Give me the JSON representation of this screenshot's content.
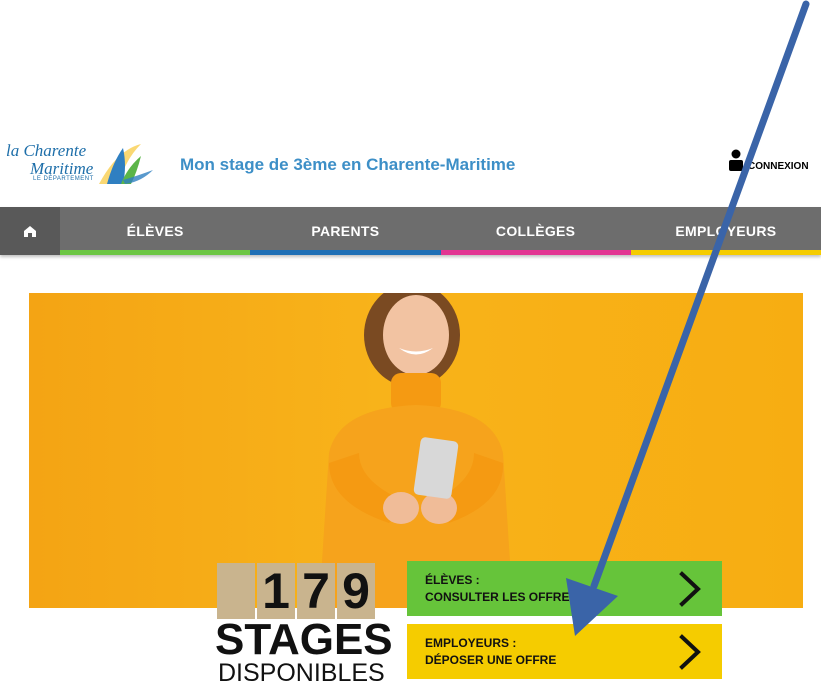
{
  "header": {
    "logo_line1": "la Charente",
    "logo_line2": "Maritime",
    "logo_line3": "LE DÉPARTEMENT",
    "site_title": "Mon stage de 3ème en Charente-Maritime",
    "connexion_label": "CONNEXION"
  },
  "nav": {
    "items": [
      {
        "label": "ÉLÈVES",
        "color": "#6cc644"
      },
      {
        "label": "PARENTS",
        "color": "#1e6fb5"
      },
      {
        "label": "COLLÈGES",
        "color": "#e23592"
      },
      {
        "label": "EMPLOYEURS",
        "color": "#f5cc00"
      }
    ]
  },
  "hero": {
    "counter_digits": [
      "",
      "1",
      "7",
      "9"
    ],
    "stages_label": "STAGES",
    "disponibles_label": "DISPONIBLES"
  },
  "cta": {
    "eleves_line1": "ÉLÈVES :",
    "eleves_line2": "CONSULTER LES OFFRES",
    "employeurs_line1": "EMPLOYEURS :",
    "employeurs_line2": "DÉPOSER UNE OFFRE"
  },
  "colors": {
    "accent_blue": "#3d8fc7",
    "annotation_arrow": "#3a64a8"
  }
}
